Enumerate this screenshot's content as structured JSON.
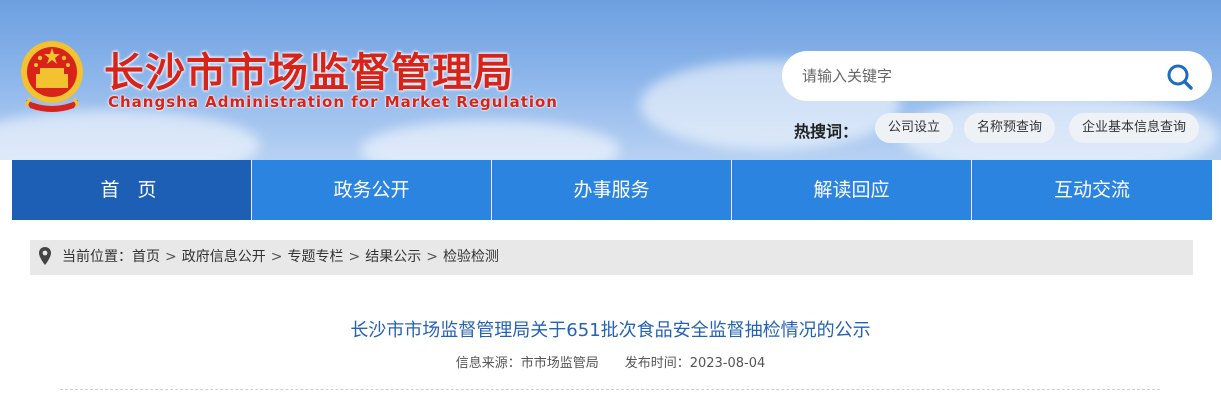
{
  "header": {
    "title": "长沙市市场监督管理局",
    "subtitle": "Changsha Administration for Market Regulation"
  },
  "search": {
    "placeholder": "请输入关键字",
    "icon": "search-icon"
  },
  "hot": {
    "label": "热搜词：",
    "tags": [
      "公司设立",
      "名称预查询",
      "企业基本信息查询"
    ]
  },
  "nav": {
    "items": [
      "首 页",
      "政务公开",
      "办事服务",
      "解读回应",
      "互动交流"
    ],
    "active_index": 0
  },
  "breadcrumb": {
    "icon": "location-pin-icon",
    "prefix": "当前位置：",
    "items": [
      "首页",
      "政府信息公开",
      "专题专栏",
      "结果公示",
      "检验检测"
    ],
    "separator": ">"
  },
  "article": {
    "title": "长沙市市场监督管理局关于651批次食品安全监督抽检情况的公示",
    "source": "信息来源：市市场监管局",
    "date": "发布时间：2023-08-04"
  },
  "colors": {
    "title_red": "#d8231b",
    "nav_blue": "#2a84e0",
    "nav_active": "#1c5fb5",
    "article_title": "#2462b5"
  }
}
